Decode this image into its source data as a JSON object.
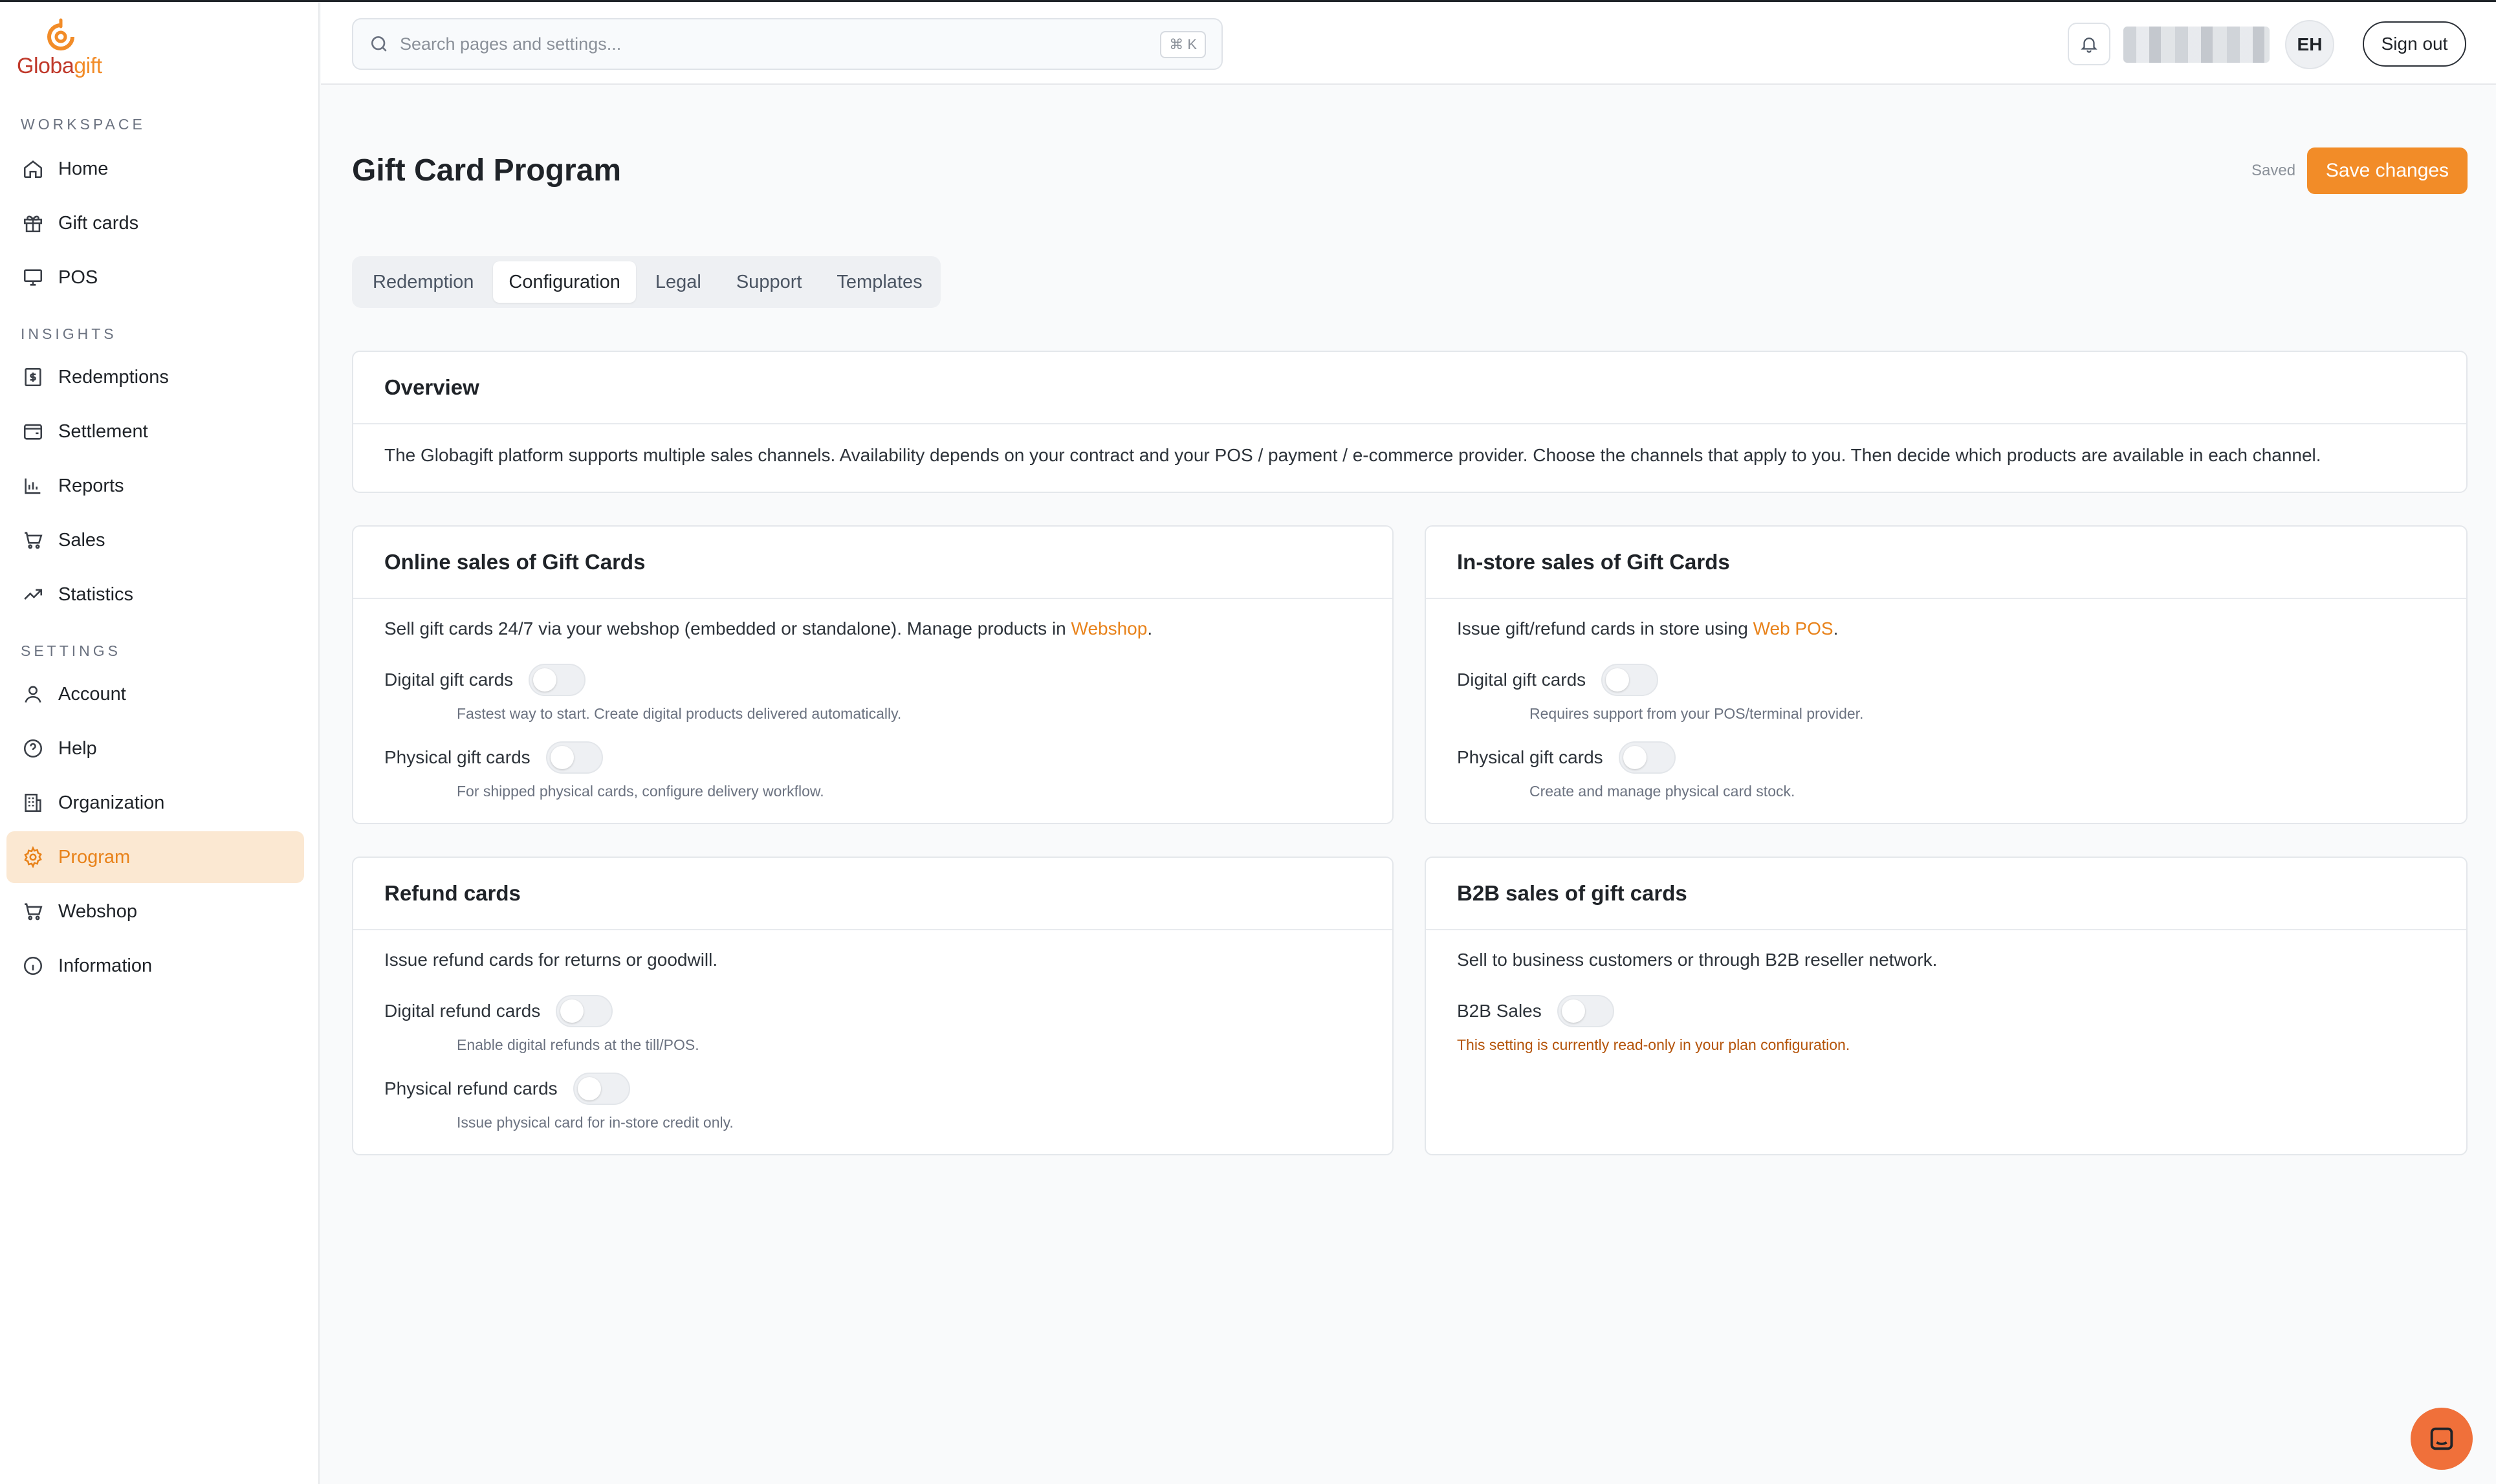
{
  "brand": {
    "logo_part1": "Globa",
    "logo_part2": "gift",
    "accent_color": "#f28c28"
  },
  "sidebar": {
    "sections": [
      {
        "title": "WORKSPACE"
      },
      {
        "title": "INSIGHTS"
      },
      {
        "title": "SETTINGS"
      }
    ],
    "items": [
      {
        "label": "Home",
        "icon": "home-icon"
      },
      {
        "label": "Gift cards",
        "icon": "gift-icon"
      },
      {
        "label": "POS",
        "icon": "monitor-icon"
      },
      {
        "label": "Redemptions",
        "icon": "receipt-icon"
      },
      {
        "label": "Settlement",
        "icon": "wallet-icon"
      },
      {
        "label": "Reports",
        "icon": "bar-chart-icon"
      },
      {
        "label": "Sales",
        "icon": "cart-icon"
      },
      {
        "label": "Statistics",
        "icon": "trend-icon"
      },
      {
        "label": "Account",
        "icon": "user-icon"
      },
      {
        "label": "Help",
        "icon": "help-circle-icon"
      },
      {
        "label": "Organization",
        "icon": "building-icon"
      },
      {
        "label": "Program",
        "icon": "gear-icon",
        "active": true
      },
      {
        "label": "Webshop",
        "icon": "cart-icon"
      },
      {
        "label": "Information",
        "icon": "info-icon"
      }
    ]
  },
  "header": {
    "search_placeholder": "Search pages and settings...",
    "search_value": "",
    "shortcut": "⌘ K",
    "avatar_initials": "EH",
    "signout_label": "Sign out"
  },
  "page": {
    "title": "Gift Card Program",
    "saved_status": "Saved",
    "save_label": "Save changes"
  },
  "tabs": [
    {
      "label": "Redemption"
    },
    {
      "label": "Configuration",
      "active": true
    },
    {
      "label": "Legal"
    },
    {
      "label": "Support"
    },
    {
      "label": "Templates"
    }
  ],
  "overview": {
    "title": "Overview",
    "text": "The Globagift platform supports multiple sales channels. Availability depends on your contract and your POS / payment / e-commerce provider. Choose the channels that apply to you. Then decide which products are available in each channel."
  },
  "online": {
    "title": "Online sales of Gift Cards",
    "desc_before": "Sell gift cards 24/7 via your webshop (embedded or standalone). Manage products in ",
    "desc_link": "Webshop",
    "desc_after": ".",
    "rows": [
      {
        "label": "Digital gift cards",
        "hint": "Fastest way to start. Create digital products delivered automatically.",
        "enabled": false
      },
      {
        "label": "Physical gift cards",
        "hint": "For shipped physical cards, configure delivery workflow.",
        "enabled": false
      }
    ]
  },
  "instore": {
    "title": "In-store sales of Gift Cards",
    "desc_before": "Issue gift/refund cards in store using ",
    "desc_link": "Web POS",
    "desc_after": ".",
    "rows": [
      {
        "label": "Digital gift cards",
        "hint": "Requires support from your POS/terminal provider.",
        "enabled": false
      },
      {
        "label": "Physical gift cards",
        "hint": "Create and manage physical card stock.",
        "enabled": false
      }
    ]
  },
  "refund": {
    "title": "Refund cards",
    "desc": "Issue refund cards for returns or goodwill.",
    "rows": [
      {
        "label": "Digital refund cards",
        "hint": "Enable digital refunds at the till/POS.",
        "enabled": false
      },
      {
        "label": "Physical refund cards",
        "hint": "Issue physical card for in-store credit only.",
        "enabled": false
      }
    ]
  },
  "b2b": {
    "title": "B2B sales of gift cards",
    "desc": "Sell to business customers or through B2B reseller network.",
    "rows": [
      {
        "label": "B2B Sales",
        "enabled": false
      }
    ],
    "warning": "This setting is currently read-only in your plan configuration."
  }
}
